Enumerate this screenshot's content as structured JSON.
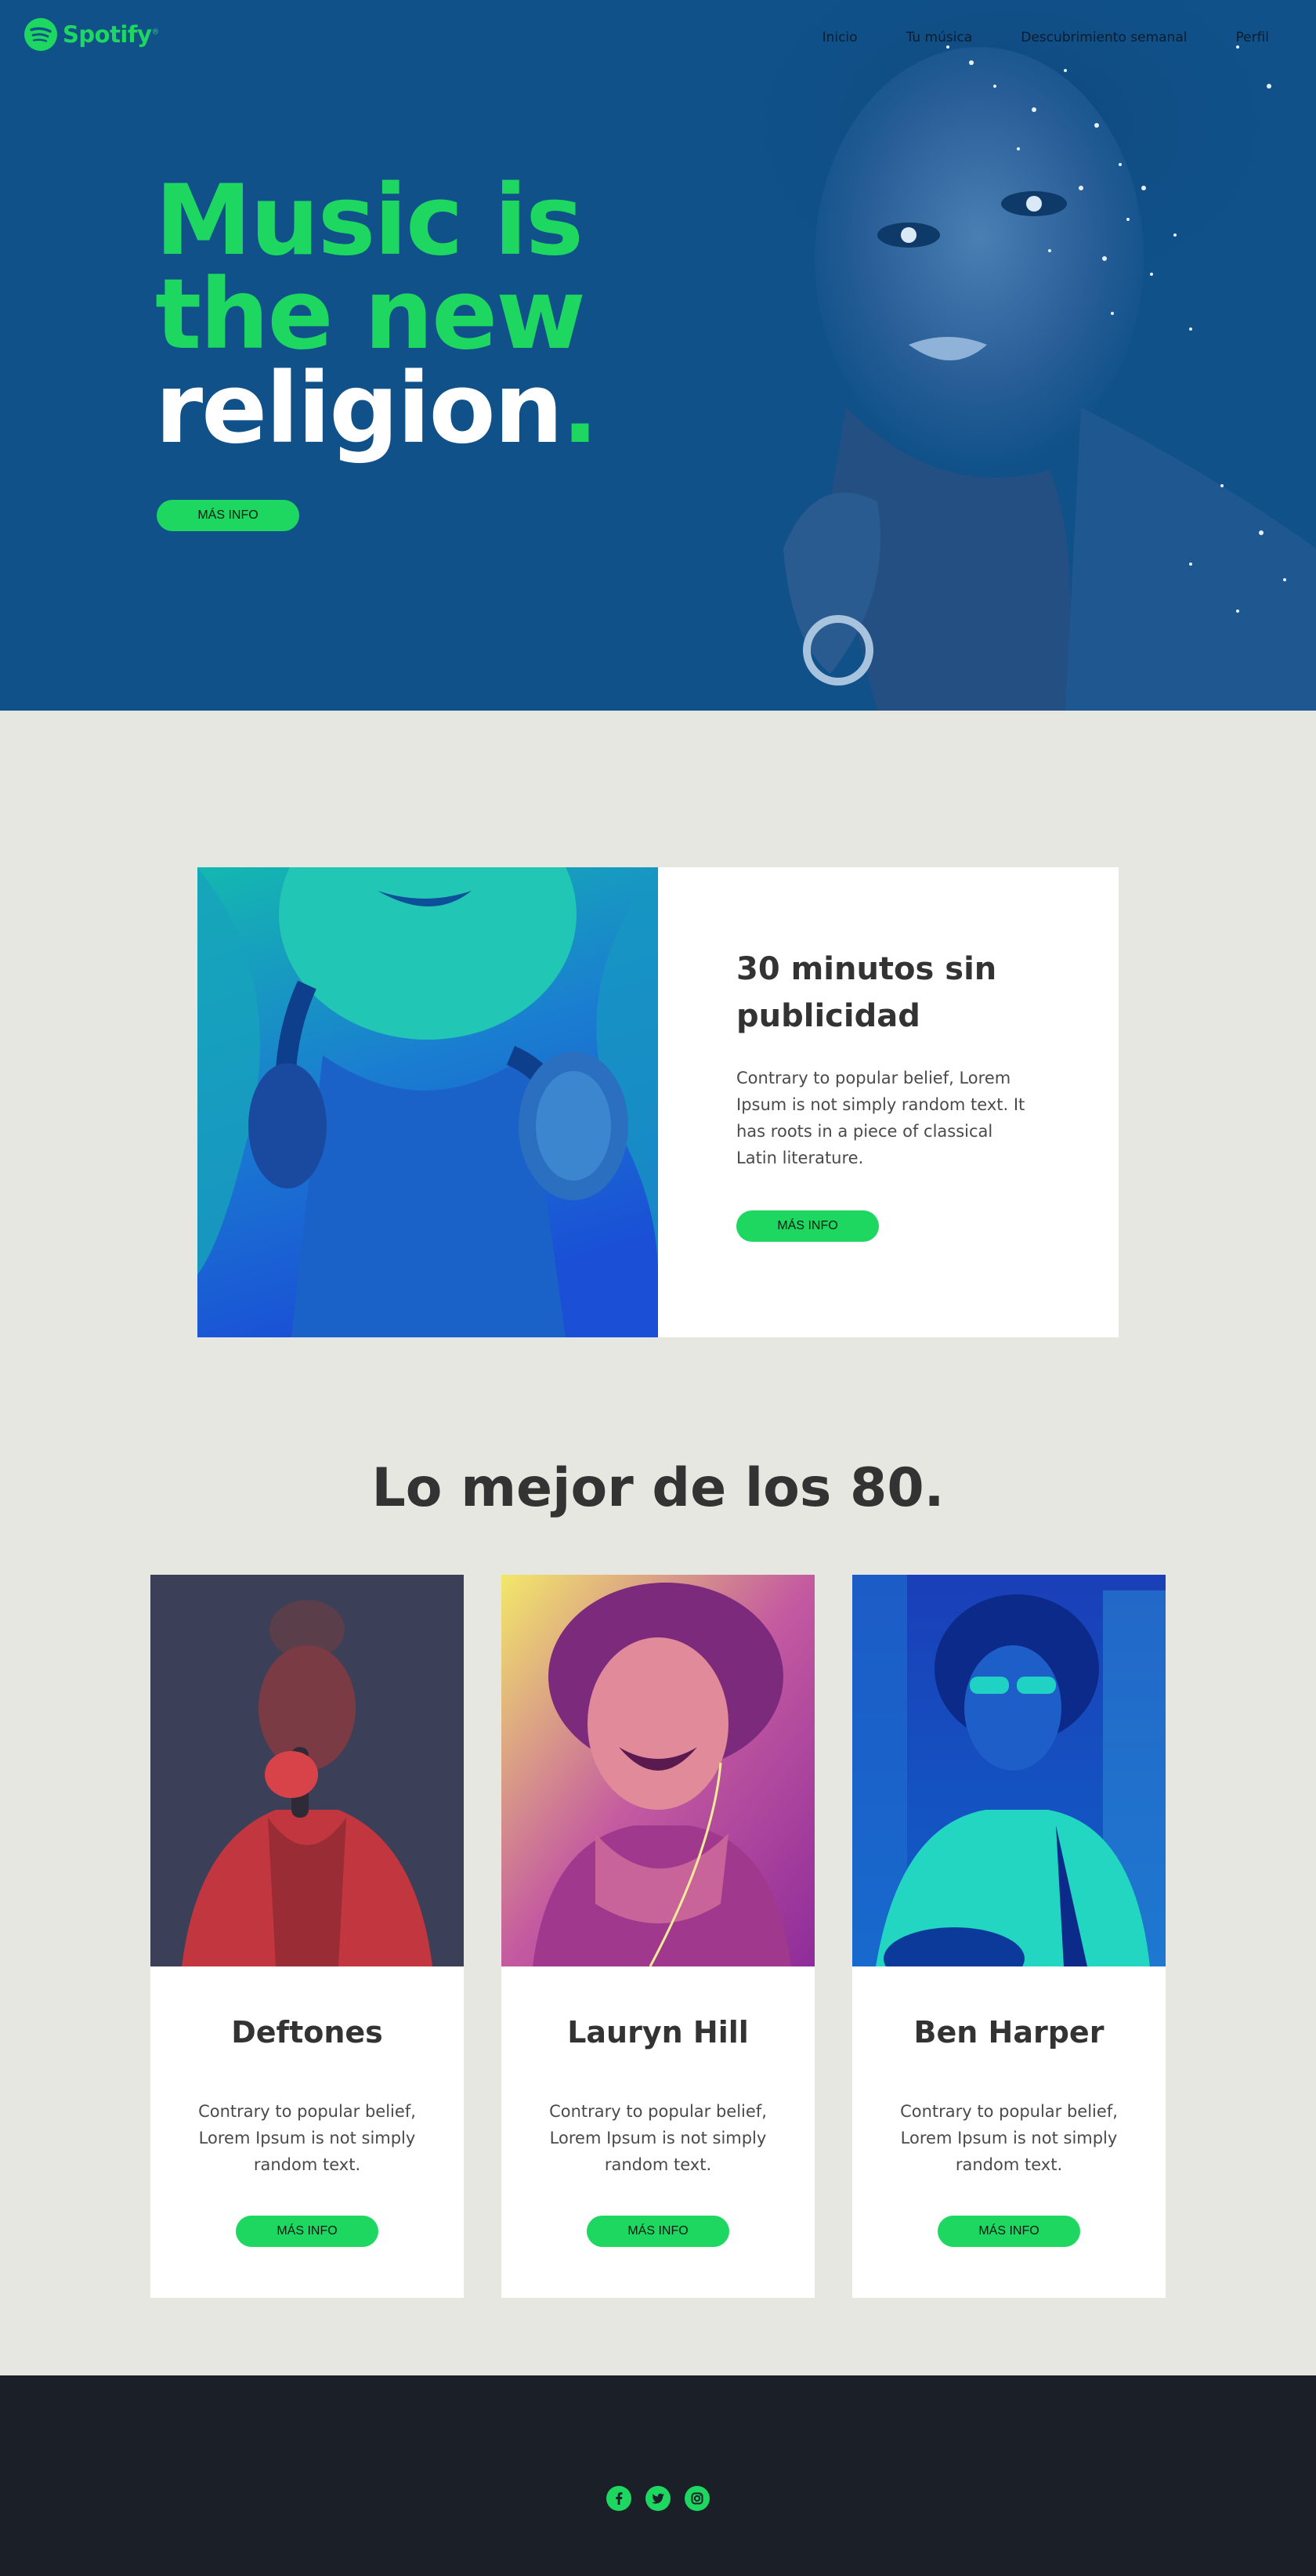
{
  "brand": {
    "name": "Spotify",
    "mark": "®",
    "accent": "#1ed760",
    "hero_bg": "#10518a"
  },
  "nav": {
    "items": [
      {
        "label": "Inicio"
      },
      {
        "label": "Tu música"
      },
      {
        "label": "Descubrimiento semanal"
      },
      {
        "label": "Perfil"
      }
    ]
  },
  "hero": {
    "line1": "Music is",
    "line2": "the new",
    "line3": "religion",
    "dot": ".",
    "cta": "MÁS INFO"
  },
  "feature": {
    "title": "30 minutos sin publicidad",
    "text": "Contrary to popular belief, Lorem Ipsum is not simply random text. It has roots in a piece of classical Latin literature.",
    "cta": "MÁS INFO"
  },
  "section": {
    "title": "Lo mejor de los 80."
  },
  "cards": [
    {
      "title": "Deftones",
      "text": "Contrary to popular belief, Lorem Ipsum is not simply random text.",
      "cta": "MÁS INFO"
    },
    {
      "title": "Lauryn Hill",
      "text": "Contrary to popular belief, Lorem Ipsum is not simply random text.",
      "cta": "MÁS INFO"
    },
    {
      "title": "Ben Harper",
      "text": "Contrary to popular belief, Lorem Ipsum is not simply random text.",
      "cta": "MÁS INFO"
    }
  ],
  "footer": {
    "social": [
      {
        "icon": "facebook-icon"
      },
      {
        "icon": "twitter-icon"
      },
      {
        "icon": "instagram-icon"
      }
    ]
  }
}
